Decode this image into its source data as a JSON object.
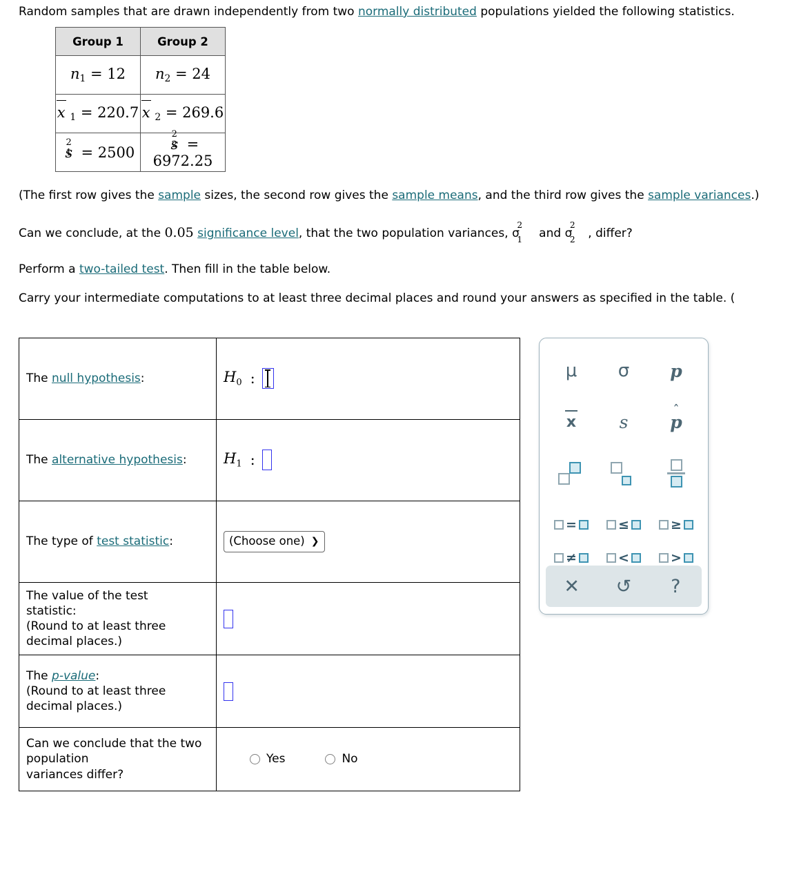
{
  "intro": {
    "line1_a": "Random samples that are drawn independently from two ",
    "line1_link": "normally distributed",
    "line1_b": " populations yielded the following statistics."
  },
  "stats_table": {
    "headers": [
      "Group 1",
      "Group 2"
    ],
    "rows": [
      {
        "g1_sym": "n",
        "g1_sub": "1",
        "g1_val": "= 12",
        "g2_sym": "n",
        "g2_sub": "2",
        "g2_val": "= 24"
      },
      {
        "g1_sym": "x",
        "g1_sub": "1",
        "g1_val": "= 220.7",
        "g2_sym": "x",
        "g2_sub": "2",
        "g2_val": "= 269.6"
      },
      {
        "g1_sym": "s",
        "g1_sub": "1",
        "g1_val": "= 2500",
        "g2_sym": "s",
        "g2_sub": "2",
        "g2_val": "= 6972.25"
      }
    ]
  },
  "para_rowdesc": {
    "a": "(The first row gives the ",
    "link1": "sample",
    "b": " sizes, the second row gives the ",
    "link2": "sample means",
    "c": ", and the third row gives the ",
    "link3": "sample variances",
    "d": ".)"
  },
  "para_conclude": {
    "a": "Can we conclude, at the ",
    "alpha": "0.05",
    "b": " ",
    "link": "significance level",
    "c": ", that the two population variances, ",
    "sigma1": "σ",
    "sigma1_sup": "2",
    "sigma1_sub": "1",
    "d": " and ",
    "sigma2": "σ",
    "sigma2_sup": "2",
    "sigma2_sub": "2",
    "e": ", differ?"
  },
  "para_perform": {
    "a": "Perform a ",
    "link": "two-tailed test",
    "b": ". Then fill in the table below."
  },
  "para_carry": {
    "text": "Carry your intermediate computations to at least three decimal places and round your answers as specified in the table. ("
  },
  "answer_table": {
    "rows": [
      {
        "label_a": "The ",
        "label_link": "null hypothesis",
        "label_b": ":",
        "hyp_sym": "H",
        "hyp_sub": "0",
        "hyp_colon": ":",
        "input_value": "",
        "focused": true
      },
      {
        "label_a": "The ",
        "label_link": "alternative hypothesis",
        "label_b": ":",
        "hyp_sym": "H",
        "hyp_sub": "1",
        "hyp_colon": ":",
        "input_value": "",
        "focused": false
      }
    ],
    "test_statistic_row": {
      "label_a": "The type of ",
      "label_link": "test statistic",
      "label_b": ":",
      "select_value": "(Choose one)",
      "select_chevron": "⌄"
    },
    "value_row": {
      "line1": "The value of the test",
      "line2": "statistic:",
      "line3": "(Round to at least three",
      "line4": "decimal places.)",
      "input_value": ""
    },
    "pvalue_row": {
      "label_a": "The ",
      "label_link": "p-value",
      "label_b": ":",
      "line2": "(Round to at least three",
      "line3": "decimal places.)",
      "input_value": ""
    },
    "conclusion_row": {
      "line1": "Can we conclude that the two population",
      "line2": "variances differ?",
      "options": [
        "Yes",
        "No"
      ],
      "selected": ""
    }
  },
  "keypad": {
    "keys": [
      {
        "name": "mu",
        "glyph": "μ"
      },
      {
        "name": "sigma",
        "glyph": "σ"
      },
      {
        "name": "p",
        "glyph": "p"
      },
      {
        "name": "x-bar",
        "glyph": "x"
      },
      {
        "name": "s",
        "glyph": "s"
      },
      {
        "name": "p-hat",
        "glyph": "p",
        "hat": "ˆ"
      },
      {
        "name": "superscript",
        "glyph": ""
      },
      {
        "name": "subscript",
        "glyph": ""
      },
      {
        "name": "fraction",
        "glyph": ""
      },
      {
        "name": "equals",
        "op": "="
      },
      {
        "name": "less-or-equal",
        "op": "≤"
      },
      {
        "name": "greater-or-equal",
        "op": "≥"
      },
      {
        "name": "not-equal",
        "op": "≠"
      },
      {
        "name": "less-than",
        "op": "<"
      },
      {
        "name": "greater-than",
        "op": ">"
      }
    ],
    "footer": [
      {
        "name": "close",
        "glyph": "✕"
      },
      {
        "name": "undo",
        "glyph": "↺"
      },
      {
        "name": "help",
        "glyph": "?"
      }
    ]
  },
  "colors": {
    "link": "#1a6b78",
    "input_border": "#3333ee",
    "keypad_text": "#4c6673",
    "keypad_border": "#9fb3bd",
    "keypad_footer_bg": "#dde5e8",
    "box_fill": "#d6ebf2",
    "box_fill_border": "#3d93b2",
    "header_bg": "#e0e0e0"
  }
}
